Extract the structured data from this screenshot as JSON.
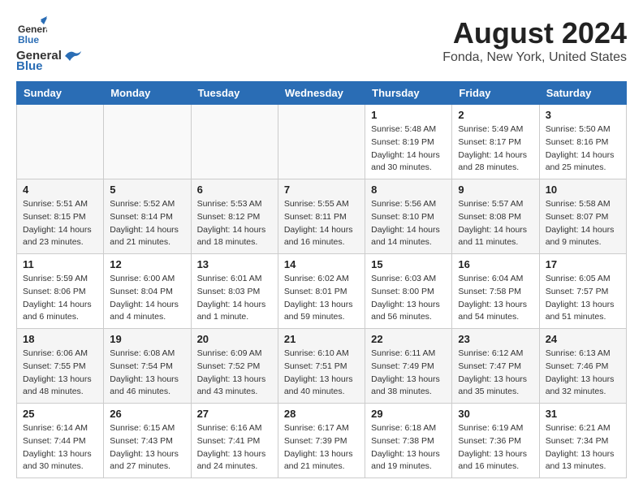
{
  "header": {
    "logo_line1": "General",
    "logo_line2": "Blue",
    "title": "August 2024",
    "subtitle": "Fonda, New York, United States"
  },
  "days_of_week": [
    "Sunday",
    "Monday",
    "Tuesday",
    "Wednesday",
    "Thursday",
    "Friday",
    "Saturday"
  ],
  "weeks": [
    [
      {
        "day": "",
        "sunrise": "",
        "sunset": "",
        "daylight": ""
      },
      {
        "day": "",
        "sunrise": "",
        "sunset": "",
        "daylight": ""
      },
      {
        "day": "",
        "sunrise": "",
        "sunset": "",
        "daylight": ""
      },
      {
        "day": "",
        "sunrise": "",
        "sunset": "",
        "daylight": ""
      },
      {
        "day": "1",
        "sunrise": "5:48 AM",
        "sunset": "8:19 PM",
        "daylight": "14 hours and 30 minutes."
      },
      {
        "day": "2",
        "sunrise": "5:49 AM",
        "sunset": "8:17 PM",
        "daylight": "14 hours and 28 minutes."
      },
      {
        "day": "3",
        "sunrise": "5:50 AM",
        "sunset": "8:16 PM",
        "daylight": "14 hours and 25 minutes."
      }
    ],
    [
      {
        "day": "4",
        "sunrise": "5:51 AM",
        "sunset": "8:15 PM",
        "daylight": "14 hours and 23 minutes."
      },
      {
        "day": "5",
        "sunrise": "5:52 AM",
        "sunset": "8:14 PM",
        "daylight": "14 hours and 21 minutes."
      },
      {
        "day": "6",
        "sunrise": "5:53 AM",
        "sunset": "8:12 PM",
        "daylight": "14 hours and 18 minutes."
      },
      {
        "day": "7",
        "sunrise": "5:55 AM",
        "sunset": "8:11 PM",
        "daylight": "14 hours and 16 minutes."
      },
      {
        "day": "8",
        "sunrise": "5:56 AM",
        "sunset": "8:10 PM",
        "daylight": "14 hours and 14 minutes."
      },
      {
        "day": "9",
        "sunrise": "5:57 AM",
        "sunset": "8:08 PM",
        "daylight": "14 hours and 11 minutes."
      },
      {
        "day": "10",
        "sunrise": "5:58 AM",
        "sunset": "8:07 PM",
        "daylight": "14 hours and 9 minutes."
      }
    ],
    [
      {
        "day": "11",
        "sunrise": "5:59 AM",
        "sunset": "8:06 PM",
        "daylight": "14 hours and 6 minutes."
      },
      {
        "day": "12",
        "sunrise": "6:00 AM",
        "sunset": "8:04 PM",
        "daylight": "14 hours and 4 minutes."
      },
      {
        "day": "13",
        "sunrise": "6:01 AM",
        "sunset": "8:03 PM",
        "daylight": "14 hours and 1 minute."
      },
      {
        "day": "14",
        "sunrise": "6:02 AM",
        "sunset": "8:01 PM",
        "daylight": "13 hours and 59 minutes."
      },
      {
        "day": "15",
        "sunrise": "6:03 AM",
        "sunset": "8:00 PM",
        "daylight": "13 hours and 56 minutes."
      },
      {
        "day": "16",
        "sunrise": "6:04 AM",
        "sunset": "7:58 PM",
        "daylight": "13 hours and 54 minutes."
      },
      {
        "day": "17",
        "sunrise": "6:05 AM",
        "sunset": "7:57 PM",
        "daylight": "13 hours and 51 minutes."
      }
    ],
    [
      {
        "day": "18",
        "sunrise": "6:06 AM",
        "sunset": "7:55 PM",
        "daylight": "13 hours and 48 minutes."
      },
      {
        "day": "19",
        "sunrise": "6:08 AM",
        "sunset": "7:54 PM",
        "daylight": "13 hours and 46 minutes."
      },
      {
        "day": "20",
        "sunrise": "6:09 AM",
        "sunset": "7:52 PM",
        "daylight": "13 hours and 43 minutes."
      },
      {
        "day": "21",
        "sunrise": "6:10 AM",
        "sunset": "7:51 PM",
        "daylight": "13 hours and 40 minutes."
      },
      {
        "day": "22",
        "sunrise": "6:11 AM",
        "sunset": "7:49 PM",
        "daylight": "13 hours and 38 minutes."
      },
      {
        "day": "23",
        "sunrise": "6:12 AM",
        "sunset": "7:47 PM",
        "daylight": "13 hours and 35 minutes."
      },
      {
        "day": "24",
        "sunrise": "6:13 AM",
        "sunset": "7:46 PM",
        "daylight": "13 hours and 32 minutes."
      }
    ],
    [
      {
        "day": "25",
        "sunrise": "6:14 AM",
        "sunset": "7:44 PM",
        "daylight": "13 hours and 30 minutes."
      },
      {
        "day": "26",
        "sunrise": "6:15 AM",
        "sunset": "7:43 PM",
        "daylight": "13 hours and 27 minutes."
      },
      {
        "day": "27",
        "sunrise": "6:16 AM",
        "sunset": "7:41 PM",
        "daylight": "13 hours and 24 minutes."
      },
      {
        "day": "28",
        "sunrise": "6:17 AM",
        "sunset": "7:39 PM",
        "daylight": "13 hours and 21 minutes."
      },
      {
        "day": "29",
        "sunrise": "6:18 AM",
        "sunset": "7:38 PM",
        "daylight": "13 hours and 19 minutes."
      },
      {
        "day": "30",
        "sunrise": "6:19 AM",
        "sunset": "7:36 PM",
        "daylight": "13 hours and 16 minutes."
      },
      {
        "day": "31",
        "sunrise": "6:21 AM",
        "sunset": "7:34 PM",
        "daylight": "13 hours and 13 minutes."
      }
    ]
  ]
}
